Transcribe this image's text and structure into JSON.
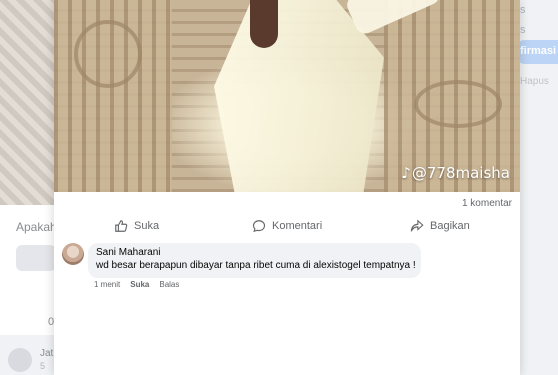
{
  "background": {
    "left_question": "Apakah",
    "left_zero": "0",
    "left_name": "Jat",
    "left_sub": "5",
    "right_text_1": "s",
    "right_text_2": "s",
    "right_confirm": "firmasi",
    "right_text_3": "Hapus"
  },
  "video": {
    "watermark_handle": "@778maisha",
    "watermark_icon": "tiktok-icon"
  },
  "post": {
    "comment_count": "1 komentar",
    "actions": {
      "like": "Suka",
      "comment": "Komentari",
      "share": "Bagikan"
    }
  },
  "comments": [
    {
      "author": "Sani Maharani",
      "text": "wd besar berapapun dibayar tanpa ribet cuma di alexistogel tempatnya !",
      "time": "1 menit",
      "like_label": "Suka",
      "reply_label": "Balas"
    }
  ]
}
